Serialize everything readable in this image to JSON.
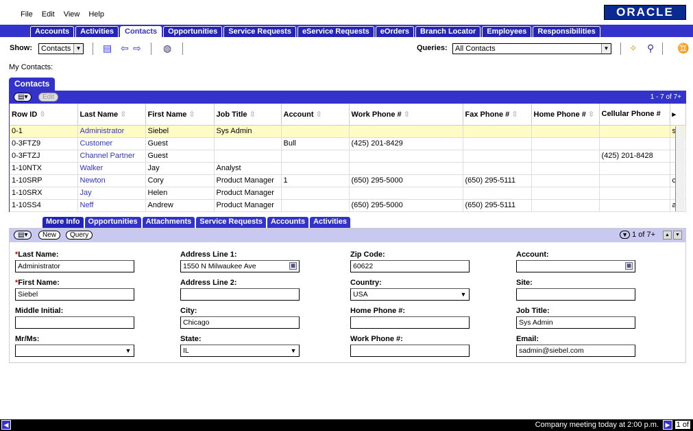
{
  "menu": [
    "File",
    "Edit",
    "View",
    "Help"
  ],
  "brand": "ORACLE",
  "screen_tabs": [
    {
      "label": "Accounts",
      "active": false
    },
    {
      "label": "Activities",
      "active": false
    },
    {
      "label": "Contacts",
      "active": true
    },
    {
      "label": "Opportunities",
      "active": false
    },
    {
      "label": "Service Requests",
      "active": false
    },
    {
      "label": "eService Requests",
      "active": false
    },
    {
      "label": "eOrders",
      "active": false
    },
    {
      "label": "Branch Locator",
      "active": false
    },
    {
      "label": "Employees",
      "active": false
    },
    {
      "label": "Responsibilities",
      "active": false
    }
  ],
  "toolbar": {
    "show_label": "Show:",
    "show_value": "Contacts",
    "queries_label": "Queries:",
    "queries_value": "All Contacts"
  },
  "page_title": "My Contacts:",
  "list_applet": {
    "title": "Contacts",
    "edit_label": "Edit",
    "count": "1 - 7 of 7+",
    "columns": [
      "Row ID",
      "Last Name",
      "First Name",
      "Job Title",
      "Account",
      "Work Phone #",
      "Fax Phone #",
      "Home Phone #",
      "Cellular Phone #",
      ""
    ],
    "rows": [
      [
        "0-1",
        "Administrator",
        "Siebel",
        "Sys Admin",
        "",
        "",
        "",
        "",
        "",
        "s"
      ],
      [
        "0-3FTZ9",
        "Customer",
        "Guest",
        "",
        "Bull",
        "(425) 201-8429",
        "",
        "",
        "",
        ""
      ],
      [
        "0-3FTZJ",
        "Channel Partner",
        "Guest",
        "",
        "",
        "",
        "",
        "",
        "(425) 201-8428",
        ""
      ],
      [
        "1-10NTX",
        "Walker",
        "Jay",
        "Analyst",
        "",
        "",
        "",
        "",
        "",
        ""
      ],
      [
        "1-10SRP",
        "Newton",
        "Cory",
        "Product Manager",
        "1",
        "(650) 295-5000",
        "(650) 295-5111",
        "",
        "",
        "c"
      ],
      [
        "1-10SRX",
        "Jay",
        "Helen",
        "Product Manager",
        "",
        "",
        "",
        "",
        "",
        ""
      ],
      [
        "1-10SS4",
        "Neff",
        "Andrew",
        "Product Manager",
        "",
        "(650) 295-5000",
        "(650) 295-5111",
        "",
        "",
        "a"
      ]
    ]
  },
  "detail_tabs": [
    {
      "label": "More Info",
      "active": true
    },
    {
      "label": "Opportunities",
      "active": false
    },
    {
      "label": "Attachments",
      "active": false
    },
    {
      "label": "Service Requests",
      "active": false
    },
    {
      "label": "Accounts",
      "active": false
    },
    {
      "label": "Activities",
      "active": false
    }
  ],
  "form": {
    "new_label": "New",
    "query_label": "Query",
    "record_count": "1 of 7+",
    "last_name_label": "Last Name:",
    "last_name": "Administrator",
    "first_name_label": "First Name:",
    "first_name": "Siebel",
    "middle_initial_label": "Middle Initial:",
    "middle_initial": "",
    "mrms_label": "Mr/Ms:",
    "mrms": "",
    "address1_label": "Address Line 1:",
    "address1": "1550 N Milwaukee Ave",
    "address2_label": "Address Line 2:",
    "address2": "",
    "city_label": "City:",
    "city": "Chicago",
    "state_label": "State:",
    "state": "IL",
    "zip_label": "Zip Code:",
    "zip": "60622",
    "country_label": "Country:",
    "country": "USA",
    "home_phone_label": "Home Phone #:",
    "home_phone": "",
    "work_phone_label": "Work Phone #:",
    "work_phone": "",
    "account_label": "Account:",
    "account": "",
    "site_label": "Site:",
    "site": "",
    "job_title_label": "Job Title:",
    "job_title": "Sys Admin",
    "email_label": "Email:",
    "email": "sadmin@siebel.com"
  },
  "status": {
    "message": "Company meeting today at 2:00 p.m.",
    "page": "1 of"
  }
}
